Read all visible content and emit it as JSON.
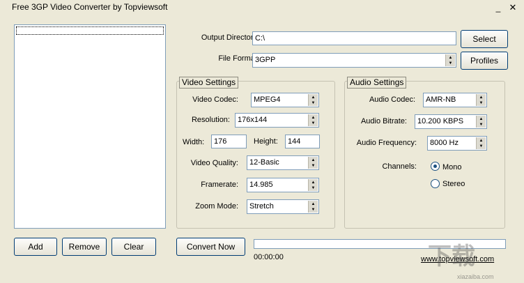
{
  "window": {
    "title": "Free 3GP Video Converter by Topviewsoft",
    "minimize_glyph": "_",
    "close_glyph": "✕"
  },
  "file_list": {
    "items": []
  },
  "left_buttons": {
    "add": "Add",
    "remove": "Remove",
    "clear": "Clear"
  },
  "output": {
    "directory_label": "Output Directory:",
    "directory_value": "C:\\",
    "select_button": "Select",
    "format_label": "File Format:",
    "format_value": "3GPP",
    "profiles_button": "Profiles"
  },
  "video_settings": {
    "legend": "Video Settings",
    "codec_label": "Video Codec:",
    "codec_value": "MPEG4",
    "resolution_label": "Resolution:",
    "resolution_value": "176x144",
    "width_label": "Width:",
    "width_value": "176",
    "height_label": "Height:",
    "height_value": "144",
    "quality_label": "Video Quality:",
    "quality_value": "12-Basic",
    "framerate_label": "Framerate:",
    "framerate_value": "14.985",
    "zoom_label": "Zoom Mode:",
    "zoom_value": "Stretch"
  },
  "audio_settings": {
    "legend": "Audio Settings",
    "codec_label": "Audio Codec:",
    "codec_value": "AMR-NB",
    "bitrate_label": "Audio Bitrate:",
    "bitrate_value": "10.200 KBPS",
    "frequency_label": "Audio Frequency:",
    "frequency_value": "8000 Hz",
    "channels_label": "Channels:",
    "channel_mono": "Mono",
    "channel_stereo": "Stereo",
    "channel_selected": "Mono"
  },
  "convert": {
    "button": "Convert Now",
    "progress_fraction": 0,
    "elapsed": "00:00:00",
    "website_link": "www.topviewsoft.com"
  },
  "colors": {
    "background": "#ece9d8",
    "border_blue": "#7f9db9",
    "button_border": "#003c74"
  }
}
